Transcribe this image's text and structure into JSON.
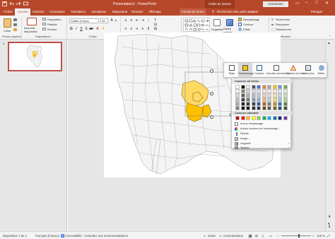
{
  "window": {
    "title": "Présentation1  -  PowerPoint",
    "tools_label": "Outils de dessin",
    "signin": "Connexion",
    "minimize": "–",
    "maximize": "□",
    "close": "✕"
  },
  "tabs": {
    "file": "Fichier",
    "home": "Accueil",
    "insert": "Insertion",
    "design": "Conception",
    "transitions": "Transitions",
    "animations": "Animations",
    "slideshow": "Diaporama",
    "review": "Révision",
    "view": "Affichage",
    "format": "Format de forme",
    "search": "Rechercher des outils adaptés",
    "share": "Partager"
  },
  "ribbon": {
    "paste": "Coller",
    "new_slide": "Nouvelle diapositive",
    "layout": "Disposition",
    "reset": "Rétablir",
    "section": "Section",
    "font_name": "Calibri (Corps)",
    "font_size": "18",
    "find": "Rechercher",
    "replace": "Remplacer",
    "select": "Sélectionner",
    "fill": "Remplissage",
    "outline": "Contour",
    "effects": "Effets",
    "arrange": "Organiser",
    "quick_styles": "Styles rapides",
    "groups": {
      "clipboard": "Presse-papiers",
      "slides": "Diapositives",
      "font": "Police",
      "paragraph": "Paragraphe",
      "drawing": "Dessin",
      "editing": "Modification"
    }
  },
  "thumbnails": {
    "slide_number": "1"
  },
  "style_panel": {
    "buttons": [
      "Style",
      "Remplissage",
      "Contour",
      "Nouvelle commentaire",
      "Créateur de forme",
      "Arrière-plan",
      "Effets"
    ]
  },
  "color_menu": {
    "theme_header": "Couleurs du thème",
    "standard_header": "Couleurs standard",
    "no_fill": "Aucun remplissage",
    "more_colors": "Autres couleurs de remplissage...",
    "eyedropper": "Pipette",
    "image": "Image...",
    "gradient": "Dégradé",
    "texture": "Texture",
    "theme_colors": [
      [
        "#ffffff",
        "#000000",
        "#e7e6e6",
        "#44546a",
        "#4472c4",
        "#ed7d31",
        "#a5a5a5",
        "#ffc000",
        "#5b9bd5",
        "#70ad47"
      ],
      [
        "#f2f2f2",
        "#7f7f7f",
        "#d0cece",
        "#d6dce5",
        "#dae3f3",
        "#fbe5d6",
        "#ededed",
        "#fff2cc",
        "#deebf7",
        "#e2f0d9"
      ],
      [
        "#d9d9d9",
        "#595959",
        "#aeabab",
        "#adb9ca",
        "#b4c7e7",
        "#f8cbad",
        "#dbdbdb",
        "#ffe699",
        "#bdd7ee",
        "#c5e0b4"
      ],
      [
        "#bfbfbf",
        "#3f3f3f",
        "#757171",
        "#8497b0",
        "#8faadc",
        "#f4b183",
        "#c9c9c9",
        "#ffd966",
        "#9dc3e6",
        "#a9d18e"
      ],
      [
        "#a6a6a6",
        "#262626",
        "#3a3838",
        "#333f50",
        "#2f5597",
        "#c55a11",
        "#7b7b7b",
        "#bf9000",
        "#2e75b6",
        "#548235"
      ],
      [
        "#7f7f7f",
        "#0d0d0d",
        "#171616",
        "#222a35",
        "#203864",
        "#843c0c",
        "#525252",
        "#7f6000",
        "#1f4e79",
        "#385723"
      ]
    ],
    "standard_colors": [
      "#c00000",
      "#ff0000",
      "#ffc000",
      "#ffff00",
      "#92d050",
      "#00b050",
      "#00b0f0",
      "#0070c0",
      "#002060",
      "#7030a0"
    ]
  },
  "statusbar": {
    "slide_info": "Diapositive 1 de 1",
    "language": "Français (France)",
    "accessibility": "Accessibilité : consultez nos recommandations",
    "notes": "Notes",
    "comments": "Commentaires",
    "zoom": "135 %"
  },
  "colors": {
    "accent": "#b7472a",
    "highlight_yellow": "#ffd966",
    "highlight_orange": "#ffc000"
  }
}
